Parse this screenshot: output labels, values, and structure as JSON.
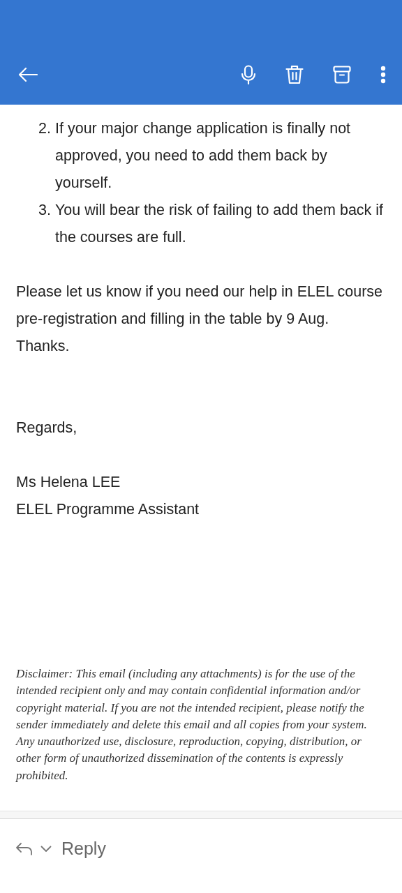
{
  "list_items": [
    {
      "number": "2.",
      "text": "If your major change application is finally not approved, you need to add them back by yourself."
    },
    {
      "number": "3.",
      "text": "You will bear the risk of failing to add them back if the courses are full."
    }
  ],
  "body": "Please let us know if you need our help in ELEL course pre-registration and filling in the table by 9 Aug. Thanks.",
  "closing": "Regards,",
  "signature": [
    "Ms Helena LEE",
    "ELEL Programme Assistant"
  ],
  "disclaimer": "Disclaimer: This email (including any attachments) is for the use of the intended recipient only and may contain confidential information and/or copyright material. If you are not the intended recipient, please notify the sender immediately and delete this email and all copies from your system. Any unauthorized use, disclosure, reproduction, copying, distribution, or other form of unauthorized dissemination of the contents is expressly prohibited.",
  "reply_button": "Reply"
}
